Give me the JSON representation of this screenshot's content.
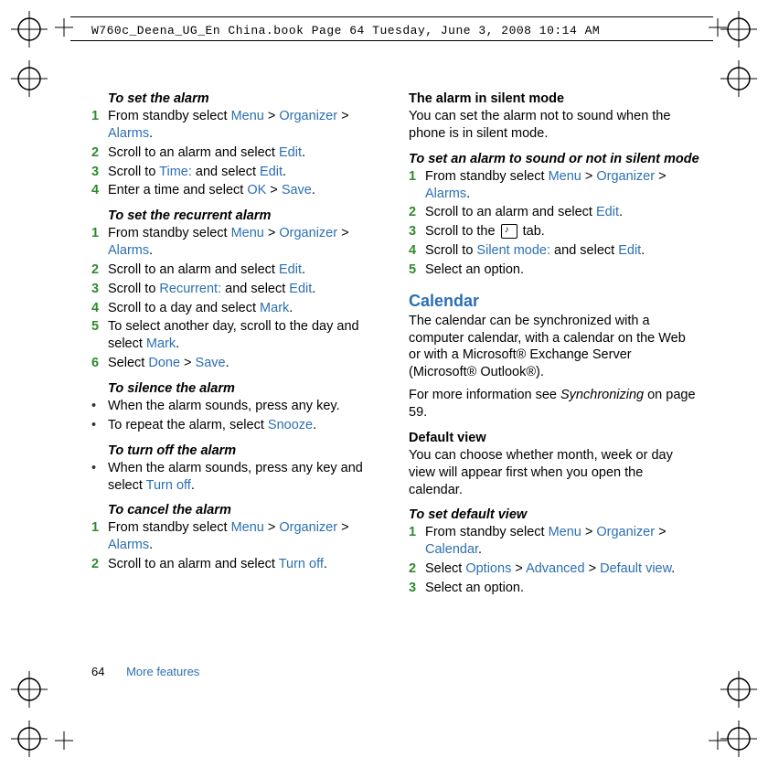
{
  "header": "W760c_Deena_UG_En China.book  Page 64  Tuesday, June 3, 2008  10:14 AM",
  "footer": {
    "page": "64",
    "section": "More features"
  },
  "left": {
    "h_set_alarm": "To set the alarm",
    "set_alarm": {
      "s1a": "From standby select ",
      "s1b": "Menu",
      "s1c": " > ",
      "s1d": "Organizer",
      "s1e": " > ",
      "s1f": "Alarms",
      "s1g": ".",
      "s2a": "Scroll to an alarm and select ",
      "s2b": "Edit",
      "s2c": ".",
      "s3a": "Scroll to ",
      "s3b": "Time:",
      "s3c": " and select ",
      "s3d": "Edit",
      "s3e": ".",
      "s4a": "Enter a time and select ",
      "s4b": "OK",
      "s4c": " > ",
      "s4d": "Save",
      "s4e": "."
    },
    "h_recurrent": "To set the recurrent alarm",
    "recurrent": {
      "s1a": "From standby select ",
      "s1b": "Menu",
      "s1c": " > ",
      "s1d": "Organizer",
      "s1e": " > ",
      "s1f": "Alarms",
      "s1g": ".",
      "s2a": "Scroll to an alarm and select ",
      "s2b": "Edit",
      "s2c": ".",
      "s3a": "Scroll to ",
      "s3b": "Recurrent:",
      "s3c": " and select ",
      "s3d": "Edit",
      "s3e": ".",
      "s4a": "Scroll to a day and select ",
      "s4b": "Mark",
      "s4c": ".",
      "s5a": "To select another day, scroll to the day and select ",
      "s5b": "Mark",
      "s5c": ".",
      "s6a": "Select ",
      "s6b": "Done",
      "s6c": " > ",
      "s6d": "Save",
      "s6e": "."
    },
    "h_silence": "To silence the alarm",
    "silence": {
      "b1": "When the alarm sounds, press any key.",
      "b2a": "To repeat the alarm, select ",
      "b2b": "Snooze",
      "b2c": "."
    },
    "h_turnoff": "To turn off the alarm",
    "turnoff": {
      "b1a": "When the alarm sounds, press any key and select ",
      "b1b": "Turn off",
      "b1c": "."
    },
    "h_cancel": "To cancel the alarm",
    "cancel": {
      "s1a": "From standby select ",
      "s1b": "Menu",
      "s1c": " > ",
      "s1d": "Organizer",
      "s1e": " > ",
      "s1f": "Alarms",
      "s1g": ".",
      "s2a": "Scroll to an alarm and select ",
      "s2b": "Turn off",
      "s2c": "."
    }
  },
  "right": {
    "h_silentmode": "The alarm in silent mode",
    "silentmode_p": "You can set the alarm not to sound when the phone is in silent mode.",
    "h_set_silent": "To set an alarm to sound or not in silent mode",
    "silent_steps": {
      "s1a": "From standby select ",
      "s1b": "Menu",
      "s1c": " > ",
      "s1d": "Organizer",
      "s1e": " > ",
      "s1f": "Alarms",
      "s1g": ".",
      "s2a": "Scroll to an alarm and select ",
      "s2b": "Edit",
      "s2c": ".",
      "s3a": "Scroll to the ",
      "s3b": " tab.",
      "s4a": "Scroll to ",
      "s4b": "Silent mode:",
      "s4c": " and select ",
      "s4d": "Edit",
      "s4e": ".",
      "s5": "Select an option."
    },
    "calendar_title": "Calendar",
    "calendar_p": "The calendar can be synchronized with a computer calendar, with a calendar on the Web or with a Microsoft® Exchange Server (Microsoft® Outlook®).",
    "sync_p_a": "For more information see ",
    "sync_p_b": "Synchronizing",
    "sync_p_c": " on page 59.",
    "h_defaultview": "Default view",
    "defaultview_p": "You can choose whether month, week or day view will appear first when you open the calendar.",
    "h_set_default": "To set default view",
    "default_steps": {
      "s1a": "From standby select ",
      "s1b": "Menu",
      "s1c": " > ",
      "s1d": "Organizer",
      "s1e": " > ",
      "s1f": "Calendar",
      "s1g": ".",
      "s2a": "Select ",
      "s2b": "Options",
      "s2c": " > ",
      "s2d": "Advanced",
      "s2e": " > ",
      "s2f": "Default view",
      "s2g": ".",
      "s3": "Select an option."
    }
  },
  "nums": {
    "n1": "1",
    "n2": "2",
    "n3": "3",
    "n4": "4",
    "n5": "5",
    "n6": "6"
  },
  "bullet": "•"
}
